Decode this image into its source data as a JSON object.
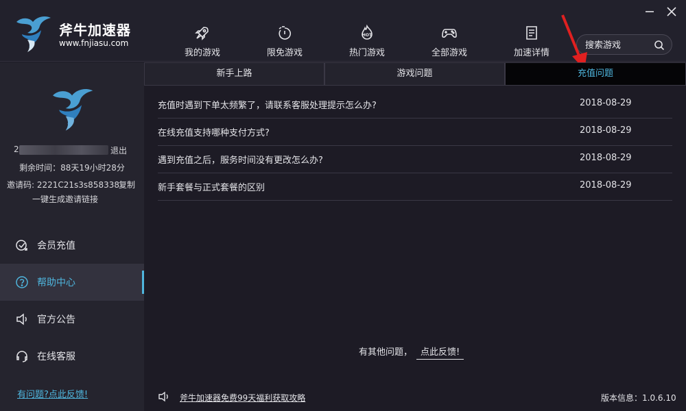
{
  "app": {
    "title": "斧牛加速器",
    "url": "www.fnjiasu.com"
  },
  "colors": {
    "accent": "#4fb6de",
    "background": "#1d1b25",
    "sidebar": "#25242e",
    "active_tab": "#050507",
    "annotation": "#e02020"
  },
  "nav": {
    "items": [
      {
        "label": "我的游戏",
        "icon": "rocket-icon"
      },
      {
        "label": "限免游戏",
        "icon": "timer-icon"
      },
      {
        "label": "热门游戏",
        "icon": "hot-icon"
      },
      {
        "label": "全部游戏",
        "icon": "gamepad-icon"
      },
      {
        "label": "加速详情",
        "icon": "document-icon"
      }
    ]
  },
  "search": {
    "placeholder": "搜索游戏",
    "icon": "search-icon"
  },
  "window": {
    "minimize_icon": "minimize-icon",
    "close_icon": "close-icon"
  },
  "user": {
    "name_prefix": "2",
    "logout": "退出",
    "remaining": "剩余时间：88天19小时28分",
    "invite_code": "邀请码: 2221C21s3s858338",
    "copy": "复制",
    "gen_link": "一键生成邀请链接"
  },
  "sidebar": {
    "items": [
      {
        "label": "会员充值",
        "icon": "recharge-icon"
      },
      {
        "label": "帮助中心",
        "icon": "help-icon"
      },
      {
        "label": "官方公告",
        "icon": "speaker-icon"
      },
      {
        "label": "在线客服",
        "icon": "headset-icon"
      }
    ],
    "active_index": 1,
    "feedback": "有问题?点此反馈!"
  },
  "tabs": {
    "items": [
      "新手上路",
      "游戏问题",
      "充值问题"
    ],
    "active_index": 2
  },
  "faq": [
    {
      "question": "充值时遇到下单太频繁了，请联系客服处理提示怎么办?",
      "date": "2018-08-29"
    },
    {
      "question": "在线充值支持哪种支付方式?",
      "date": "2018-08-29"
    },
    {
      "question": "遇到充值之后，服务时间没有更改怎么办?",
      "date": "2018-08-29"
    },
    {
      "question": "新手套餐与正式套餐的区别",
      "date": "2018-08-29"
    }
  ],
  "footer": {
    "other_question": "有其他问题，",
    "other_link": "点此反馈!",
    "promo": "斧牛加速器免费99天福利获取攻略",
    "version": "版本信息：1.0.6.10"
  }
}
